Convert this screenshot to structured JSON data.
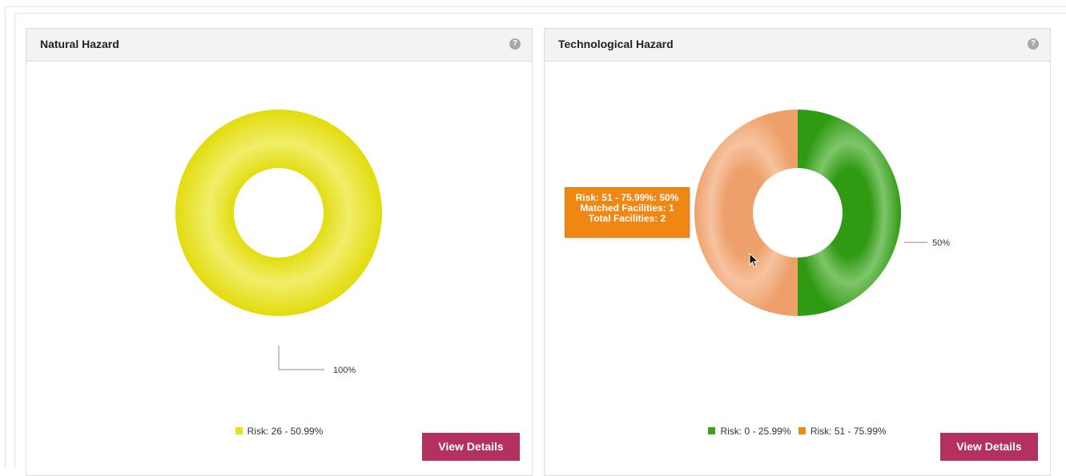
{
  "panels": {
    "natural": {
      "title": "Natural Hazard",
      "help_icon": "?",
      "view_details_label": "View Details",
      "legend": [
        {
          "label": "Risk: 26 - 50.99%",
          "color": "#e6e01a"
        }
      ],
      "slice_labels": [
        {
          "text": "100%"
        }
      ]
    },
    "technological": {
      "title": "Technological Hazard",
      "help_icon": "?",
      "view_details_label": "View Details",
      "legend": [
        {
          "label": "Risk: 0 - 25.99%",
          "color": "#3aa11c"
        },
        {
          "label": "Risk: 51 - 75.99%",
          "color": "#f08712"
        }
      ],
      "slice_labels": [
        {
          "text": "50%"
        }
      ],
      "tooltip": {
        "line1": "Risk: 51 - 75.99%: 50%",
        "line2": "Matched Facilities: 1",
        "line3": "Total Facilities: 2"
      }
    }
  },
  "chart_data": [
    {
      "type": "pie",
      "title": "Natural Hazard",
      "categories": [
        "Risk: 26 - 50.99%"
      ],
      "values": [
        100
      ],
      "colors": [
        "#e6e01a"
      ],
      "donut": true
    },
    {
      "type": "pie",
      "title": "Technological Hazard",
      "categories": [
        "Risk: 0 - 25.99%",
        "Risk: 51 - 75.99%"
      ],
      "values": [
        50,
        50
      ],
      "colors": [
        "#3aa11c",
        "#f2a66a"
      ],
      "donut": true
    }
  ]
}
